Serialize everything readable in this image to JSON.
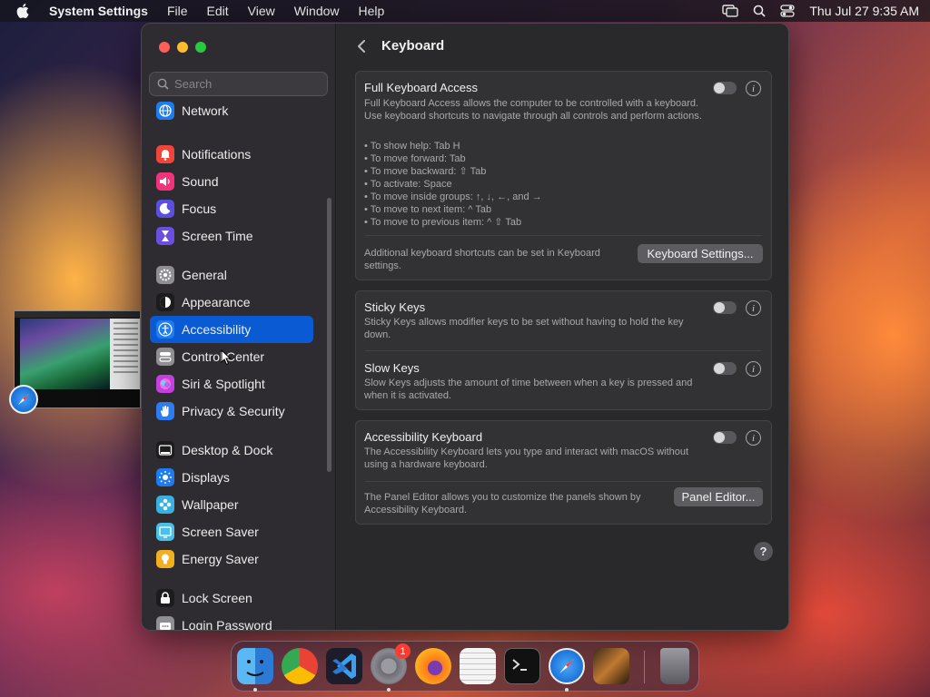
{
  "menubar": {
    "app_name": "System Settings",
    "items": [
      "File",
      "Edit",
      "View",
      "Window",
      "Help"
    ],
    "datetime": "Thu Jul 27  9:35 AM"
  },
  "window": {
    "search_placeholder": "Search",
    "sidebar_items": [
      {
        "label": "Network",
        "icon": "globe-icon",
        "color": "#1e7cf2"
      },
      {
        "label": "Notifications",
        "icon": "bell-icon",
        "color": "#f0453a"
      },
      {
        "label": "Sound",
        "icon": "speaker-icon",
        "color": "#f0337a"
      },
      {
        "label": "Focus",
        "icon": "moon-icon",
        "color": "#5b4fe0"
      },
      {
        "label": "Screen Time",
        "icon": "hourglass-icon",
        "color": "#6a4fe0"
      },
      {
        "label": "General",
        "icon": "gear-icon",
        "color": "#8e8e93"
      },
      {
        "label": "Appearance",
        "icon": "appearance-icon",
        "color": "#1c1c1e"
      },
      {
        "label": "Accessibility",
        "icon": "accessibility-icon",
        "color": "#1e7cf2"
      },
      {
        "label": "Control Center",
        "icon": "toggles-icon",
        "color": "#8e8e93"
      },
      {
        "label": "Siri & Spotlight",
        "icon": "siri-icon",
        "color": "#c040e0"
      },
      {
        "label": "Privacy & Security",
        "icon": "hand-icon",
        "color": "#2e7cf2"
      },
      {
        "label": "Desktop & Dock",
        "icon": "dock-icon",
        "color": "#1c1c1e"
      },
      {
        "label": "Displays",
        "icon": "sun-icon",
        "color": "#1e7cf2"
      },
      {
        "label": "Wallpaper",
        "icon": "flower-icon",
        "color": "#3ab0e0"
      },
      {
        "label": "Screen Saver",
        "icon": "screensaver-icon",
        "color": "#4ac0e8"
      },
      {
        "label": "Energy Saver",
        "icon": "bulb-icon",
        "color": "#f0b020"
      },
      {
        "label": "Lock Screen",
        "icon": "lock-icon",
        "color": "#1c1c1e"
      },
      {
        "label": "Login Password",
        "icon": "login-icon",
        "color": "#8e8e93"
      }
    ],
    "selected": "Accessibility",
    "page_title": "Keyboard",
    "fka": {
      "title": "Full Keyboard Access",
      "desc": "Full Keyboard Access allows the computer to be controlled with a keyboard. Use keyboard shortcuts to navigate through all controls and perform actions.",
      "bullets": [
        "• To show help: Tab H",
        "• To move forward: Tab",
        "• To move backward: ⇧ Tab",
        "• To activate: Space",
        "• To move inside groups: ↑, ↓, ←, and →",
        "• To move to next item: ^ Tab",
        "• To move to previous item: ^ ⇧ Tab"
      ],
      "extra": "Additional keyboard shortcuts can be set in Keyboard settings.",
      "button": "Keyboard Settings..."
    },
    "sticky": {
      "title": "Sticky Keys",
      "desc": "Sticky Keys allows modifier keys to be set without having to hold the key down."
    },
    "slow": {
      "title": "Slow Keys",
      "desc": "Slow Keys adjusts the amount of time between when a key is pressed and when it is activated."
    },
    "akb": {
      "title": "Accessibility Keyboard",
      "desc": "The Accessibility Keyboard lets you type and interact with macOS without using a hardware keyboard.",
      "extra": "The Panel Editor allows you to customize the panels shown by Accessibility Keyboard.",
      "button": "Panel Editor..."
    },
    "info_glyph": "i",
    "help_glyph": "?"
  },
  "dock": {
    "apps": [
      {
        "name": "Finder",
        "icon": "finder-icon",
        "running": true
      },
      {
        "name": "Chrome",
        "icon": "chrome-icon",
        "running": false
      },
      {
        "name": "VS Code",
        "icon": "vscode-icon",
        "running": false
      },
      {
        "name": "System Settings",
        "icon": "settings-icon",
        "running": true,
        "badge": "1"
      },
      {
        "name": "Firefox",
        "icon": "firefox-icon",
        "running": false
      },
      {
        "name": "TextEdit",
        "icon": "textedit-icon",
        "running": false
      },
      {
        "name": "Terminal",
        "icon": "terminal-icon",
        "running": false
      },
      {
        "name": "Safari",
        "icon": "safari-icon",
        "running": true
      },
      {
        "name": "GarageBand",
        "icon": "guitar-icon",
        "running": false
      },
      {
        "name": "Trash",
        "icon": "trash-icon",
        "running": false
      }
    ]
  }
}
